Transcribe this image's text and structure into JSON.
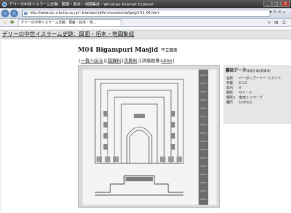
{
  "window": {
    "title": "デリーの中世イスラーム史跡：図面・拓本・地図集成 - Windows Internet Explorer",
    "controls": [
      "_",
      "□",
      "×"
    ]
  },
  "address_bar": {
    "url": "http://www.ioc.u-tokyo.ac.jp/~islamarc/delhi-monuments/jpeg/t-01_06.html",
    "tools": "▾ ↻ ✕"
  },
  "tabs": {
    "active_tab": "デリーの中世イスラーム史跡：図面・拓本・地..."
  },
  "command_bar": "⌂ · ▤ · ⎙ ·",
  "site": {
    "header_link": "デリーの中世イスラーム史跡：図面・拓本・地図集成"
  },
  "page": {
    "title": "M04  Bigampuri Masjid",
    "title_jp": "平立面図",
    "nav": {
      "list_link": "一覧へ戻る",
      "prev_link": "前資料",
      "next_link": "次資料",
      "detail_label": "詳細画像:",
      "detail_link": "Lime"
    }
  },
  "metadata": {
    "heading": "書誌データ",
    "heading_note": "(図面目録記載事項)",
    "rows": [
      {
        "key": "名称",
        "value": "ベーガンプーリー マスジド"
      },
      {
        "key": "作業",
        "value": "D-12"
      },
      {
        "key": "年代",
        "value": "II"
      },
      {
        "key": "場所",
        "value": "ザナーナ"
      },
      {
        "key": "場所2",
        "value": "南西ミフラーブ"
      },
      {
        "key": "種尺",
        "value": "1/20の1"
      }
    ]
  },
  "colors": {
    "titlebar": "#3c3c3c",
    "header_bg": "#e4e4e4",
    "image_frame": "#d9d9d9",
    "meta_bg": "#e6e6e6"
  }
}
